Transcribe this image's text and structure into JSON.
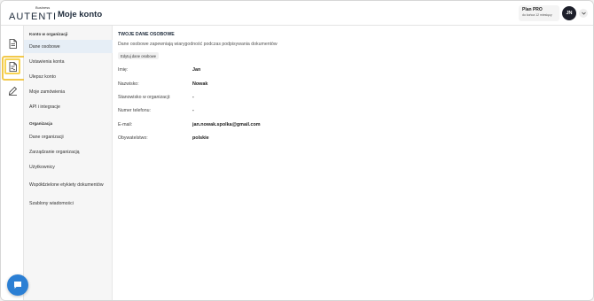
{
  "header": {
    "logo_small": "Business",
    "logo_text": "AUTENTI",
    "page_title": "Moje konto",
    "plan_name": "Plan PRO",
    "plan_sub": "do końca 12 miesięcy",
    "avatar_initials": "JN"
  },
  "rail": {
    "items": [
      {
        "icon": "document-icon"
      },
      {
        "icon": "document-signed-icon",
        "active": true
      },
      {
        "icon": "pen-icon"
      }
    ]
  },
  "submenu": {
    "section1": "Konto w organizacji",
    "items1": [
      "Dane osobowe",
      "Ustawienia konta",
      "Ulepsz konto",
      "Moje zamówienia",
      "API i integracje"
    ],
    "section2": "Organizacja",
    "items2": [
      "Dane organizacji",
      "Zarządzanie organizacją",
      "Użytkownicy",
      "Współdzielone etykiety dokumentów",
      "Szablony wiadomości"
    ]
  },
  "main": {
    "title": "TWOJE DANE OSOBOWE",
    "description": "Dane osobowe zapewniają wiarygodność podczas podpisywania dokumentów",
    "edit_button": "Edytuj dane osobowe",
    "fields": [
      {
        "label": "Imię:",
        "value": "Jan"
      },
      {
        "label": "Nazwisko:",
        "value": "Nowak"
      },
      {
        "label": "Stanowisko w organizacji:",
        "value": "-"
      },
      {
        "label": "Numer telefonu:",
        "value": "-"
      },
      {
        "label": "E-mail:",
        "value": "jan.nowak.spolka@gmail.com"
      },
      {
        "label": "Obywatelstwo:",
        "value": "polskie"
      }
    ]
  },
  "colors": {
    "accent": "#f2c94c",
    "active_bg": "#e6eef6",
    "chat": "#2b7fd4",
    "avatar_bg": "#1d1f2a"
  }
}
